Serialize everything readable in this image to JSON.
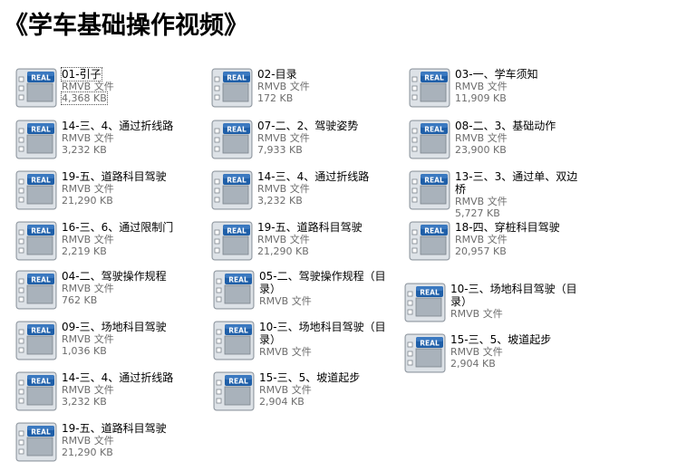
{
  "page_title": "《学车基础操作视频》",
  "icon": {
    "name": "real-media-file-icon",
    "label": "REAL",
    "accent": "#1f5fa8"
  },
  "files": [
    {
      "name": "01-引子",
      "type": "RMVB 文件",
      "size": "4,368 KB",
      "selected": true
    },
    {
      "name": "02-目录",
      "type": "RMVB 文件",
      "size": "172 KB"
    },
    {
      "name": "03-一、学车须知",
      "type": "RMVB 文件",
      "size": "11,909 KB"
    },
    {
      "name": "14-三、4、通过折线路",
      "type": "RMVB 文件",
      "size": "3,232 KB"
    },
    {
      "name": "07-二、2、驾驶姿势",
      "type": "RMVB 文件",
      "size": "7,933 KB"
    },
    {
      "name": "08-二、3、基础动作",
      "type": "RMVB 文件",
      "size": "23,900 KB"
    },
    {
      "name": "19-五、道路科目驾驶",
      "type": "RMVB 文件",
      "size": "21,290 KB"
    },
    {
      "name": "14-三、4、通过折线路",
      "type": "RMVB 文件",
      "size": "3,232 KB"
    },
    {
      "name": "13-三、3、通过单、双边桥",
      "type": "RMVB 文件",
      "size": "5,727 KB"
    },
    {
      "name": "16-三、6、通过限制门",
      "type": "RMVB 文件",
      "size": "2,219 KB"
    },
    {
      "name": "19-五、道路科目驾驶",
      "type": "RMVB 文件",
      "size": "21,290 KB"
    },
    {
      "name": "18-四、穿桩科目驾驶",
      "type": "RMVB 文件",
      "size": "20,957 KB"
    },
    {
      "name": "04-二、驾驶操作规程",
      "type": "RMVB 文件",
      "size": "762 KB"
    },
    {
      "name": "05-二、驾驶操作规程（目录）",
      "type": "RMVB 文件",
      "size": ""
    },
    {
      "name": "10-三、场地科目驾驶（目录）",
      "type": "RMVB 文件",
      "size": ""
    },
    {
      "name": "09-三、场地科目驾驶",
      "type": "RMVB 文件",
      "size": "1,036 KB"
    },
    {
      "name": "10-三、场地科目驾驶（目录）",
      "type": "RMVB 文件",
      "size": ""
    },
    {
      "name": "15-三、5、坡道起步",
      "type": "RMVB 文件",
      "size": "2,904 KB"
    },
    {
      "name": "14-三、4、通过折线路",
      "type": "RMVB 文件",
      "size": "3,232 KB"
    },
    {
      "name": "15-三、5、坡道起步",
      "type": "RMVB 文件",
      "size": "2,904 KB"
    },
    {
      "name": "19-五、道路科目驾驶",
      "type": "RMVB 文件",
      "size": "21,290 KB"
    }
  ]
}
